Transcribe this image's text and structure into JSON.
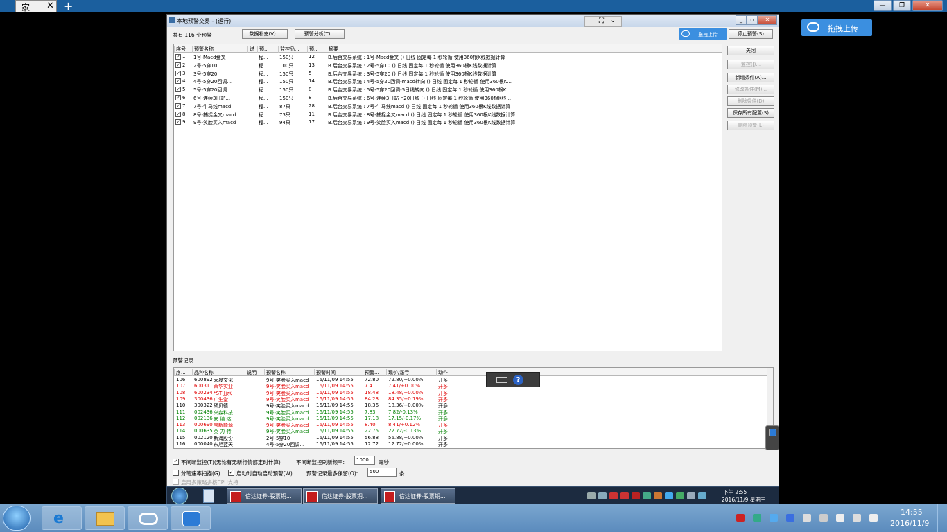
{
  "outer_tab": {
    "label": "家",
    "close": "✕",
    "new_tab": "+"
  },
  "outer_window_controls": {
    "min": "—",
    "max": "❐",
    "close": "✕"
  },
  "upload_label": "拖拽上传",
  "window": {
    "title": "本地预警交易 - (运行)",
    "count_label": "共有 116 个预警",
    "btn_data_fill": "数据补充(V)...",
    "btn_alert_analysis": "预警分析(T)...",
    "btn_stop_alert": "停止预警(S)",
    "side_buttons": [
      {
        "label": "关闭",
        "disabled": false
      },
      {
        "label": "监控(J)...",
        "disabled": true
      },
      {
        "label": "新增条件(A)...",
        "disabled": false
      },
      {
        "label": "修改条件(M)...",
        "disabled": true
      },
      {
        "label": "删除条件(D)",
        "disabled": true
      },
      {
        "label": "保存所有配置(S)",
        "disabled": false
      },
      {
        "label": "删除预警(L)",
        "disabled": true
      }
    ]
  },
  "alerts_table": {
    "headers": [
      "序号",
      "预警名称",
      "说",
      "预...",
      "监控品...",
      "预...",
      "摘要"
    ],
    "rows": [
      [
        "1",
        "1号-Macd金叉",
        "",
        "程...",
        "150只",
        "12",
        "B.后台交易系统 : 1号-Macd金叉 () 日线 固定每 1 秒轮循 使用360根K线数据计算"
      ],
      [
        "2",
        "2号-5穿10",
        "",
        "程...",
        "100只",
        "13",
        "B.后台交易系统 : 2号-5穿10 () 日线 固定每 1 秒轮循 使用360根K线数据计算"
      ],
      [
        "3",
        "3号-5穿20",
        "",
        "程...",
        "150只",
        "5",
        "B.后台交易系统 : 3号-5穿20 () 日线 固定每 1 秒轮循 使用360根K线数据计算"
      ],
      [
        "4",
        "4号-5穿20回调...",
        "",
        "程...",
        "150只",
        "14",
        "B.后台交易系统 : 4号-5穿20回调-macd转向 () 日线 固定每 1 秒轮循 使用360根K..."
      ],
      [
        "5",
        "5号-5穿20回调...",
        "",
        "程...",
        "150只",
        "8",
        "B.后台交易系统 : 5号-5穿20回调-5日线转向 () 日线 固定每 1 秒轮循 使用360根K..."
      ],
      [
        "6",
        "6号-连续3日站...",
        "",
        "程...",
        "150只",
        "8",
        "B.后台交易系统 : 6号-连续3日站上20日线 () 日线 固定每 1 秒轮循 使用360根K线..."
      ],
      [
        "7",
        "7号-牛马线macd",
        "",
        "程...",
        "87只",
        "28",
        "B.后台交易系统 : 7号-牛马线macd () 日线 固定每 1 秒轮循 使用360根K线数据计算"
      ],
      [
        "8",
        "8号-捕捉金叉macd",
        "",
        "程...",
        "73只",
        "11",
        "B.后台交易系统 : 8号-捕捉金叉macd () 日线 固定每 1 秒轮循 使用360根K线数据计算"
      ],
      [
        "9",
        "9号-笑脸买入macd",
        "",
        "程...",
        "94只",
        "17",
        "B.后台交易系统 : 9号-笑脸买入macd () 日线 固定每 1 秒轮循 使用360根K线数据计算"
      ]
    ]
  },
  "records_label": "预警记录:",
  "records_table": {
    "headers": [
      "序...",
      "品种名称",
      "说明",
      "预警名称",
      "预警时间",
      "预警...",
      "现价/涨亏",
      "动作"
    ],
    "rows": [
      {
        "c": [
          "106",
          "600892",
          "大晟文化",
          "9号-笑脸买入macd",
          "16/11/09 14:55",
          "72.80",
          "72.80/+0.00%",
          "开多"
        ],
        "color": "#000000"
      },
      {
        "c": [
          "107",
          "600311",
          "荣华实业",
          "9号-笑脸买入macd",
          "16/11/09 14:55",
          "7.41",
          "7.41/+0.00%",
          "开多"
        ],
        "color": "#e00000"
      },
      {
        "c": [
          "108",
          "600234",
          "*ST山水",
          "9号-笑脸买入macd",
          "16/11/09 14:55",
          "18.48",
          "18.48/+0.00%",
          "开多"
        ],
        "color": "#e00000"
      },
      {
        "c": [
          "109",
          "300436",
          "广生堂",
          "9号-笑脸买入macd",
          "16/11/09 14:55",
          "84.23",
          "84.35/+0.19%",
          "开多"
        ],
        "color": "#e00000"
      },
      {
        "c": [
          "110",
          "300322",
          "硕贝德",
          "9号-笑脸买入macd",
          "16/11/09 14:55",
          "18.36",
          "18.36/+0.00%",
          "开多"
        ],
        "color": "#000000"
      },
      {
        "c": [
          "111",
          "002436",
          "兴森科技",
          "9号-笑脸买入macd",
          "16/11/09 14:55",
          "7.83",
          "7.82/-0.13%",
          "开多"
        ],
        "color": "#008000"
      },
      {
        "c": [
          "112",
          "002136",
          "安 纳 达",
          "9号-笑脸买入macd",
          "16/11/09 14:55",
          "17.18",
          "17.15/-0.17%",
          "开多"
        ],
        "color": "#008000"
      },
      {
        "c": [
          "113",
          "000690",
          "宝新能源",
          "9号-笑脸买入macd",
          "16/11/09 14:55",
          "8.40",
          "8.41/+0.12%",
          "开多"
        ],
        "color": "#e00000"
      },
      {
        "c": [
          "114",
          "000635",
          "英 力 特",
          "9号-笑脸买入macd",
          "16/11/09 14:55",
          "22.75",
          "22.72/-0.13%",
          "开多"
        ],
        "color": "#008000"
      },
      {
        "c": [
          "115",
          "002120",
          "新海股份",
          "2号-5穿10",
          "16/11/09 14:55",
          "56.88",
          "56.88/+0.00%",
          "开多"
        ],
        "color": "#000000"
      },
      {
        "c": [
          "116",
          "000040",
          "东旭蓝天",
          "4号-5穿20回调...",
          "16/11/09 14:55",
          "12.72",
          "12.72/+0.00%",
          "开多"
        ],
        "color": "#000000"
      }
    ]
  },
  "options": {
    "continuous_monitor": "不间断监控(T)(无论有无新行情都定时计算)",
    "continuous_freq_label": "不间断监控刷新频率:",
    "continuous_freq_value": "1000",
    "continuous_freq_unit": "毫秒",
    "tick_scan": "分笔速率扫描(G)",
    "auto_start": "启动时自动启动预警(W)",
    "max_records_label": "预警记录最多保留(O):",
    "max_records_value": "500",
    "max_records_unit": "条",
    "multi_core": "启用多策略多核CPU支持"
  },
  "inner_taskbar": {
    "apps": [
      "信达证券-股票期...",
      "信达证券-股票期...",
      "信达证券-股票期..."
    ],
    "clock_time": "下午 2:55",
    "clock_date": "2016/11/9 星期三"
  },
  "outer_taskbar": {
    "clock_time": "14:55",
    "clock_date": "2016/11/9"
  },
  "colors": {
    "accent": "#3b8fe0",
    "up": "#e00000",
    "down": "#008000"
  }
}
